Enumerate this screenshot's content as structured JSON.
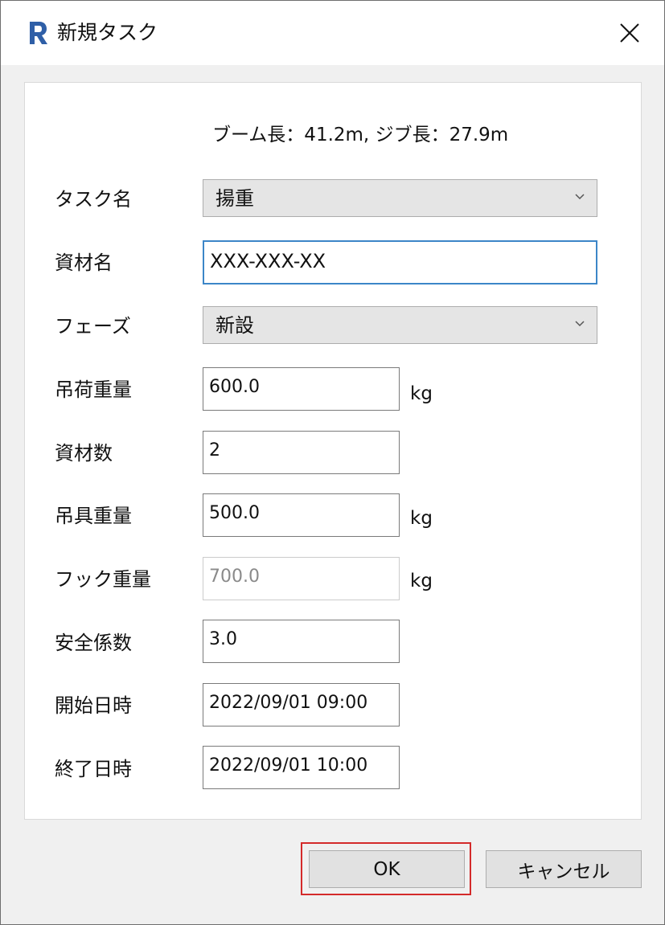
{
  "window": {
    "title": "新規タスク"
  },
  "info": {
    "boom_label": "ブーム長：41.2m,",
    "jib_label": "ジブ長：27.9m"
  },
  "fields": {
    "task_name": {
      "label": "タスク名",
      "value": "揚重"
    },
    "material_name": {
      "label": "資材名",
      "value": "XXX-XXX-XX"
    },
    "phase": {
      "label": "フェーズ",
      "value": "新設"
    },
    "load_weight": {
      "label": "吊荷重量",
      "value": "600.0",
      "unit": "kg"
    },
    "material_count": {
      "label": "資材数",
      "value": "2"
    },
    "rigging_weight": {
      "label": "吊具重量",
      "value": "500.0",
      "unit": "kg"
    },
    "hook_weight": {
      "label": "フック重量",
      "value": "700.0",
      "unit": "kg"
    },
    "safety_factor": {
      "label": "安全係数",
      "value": "3.0"
    },
    "start_datetime": {
      "label": "開始日時",
      "value": "2022/09/01 09:00"
    },
    "end_datetime": {
      "label": "終了日時",
      "value": "2022/09/01 10:00"
    }
  },
  "buttons": {
    "ok": "OK",
    "cancel": "キャンセル"
  },
  "icons": {
    "app": "revit-r-icon",
    "close": "close-icon",
    "dropdown": "chevron-down-icon"
  },
  "colors": {
    "focus_border": "#3c86c8",
    "highlight_frame": "#d42a2a",
    "app_icon": "#2f5fa7"
  }
}
